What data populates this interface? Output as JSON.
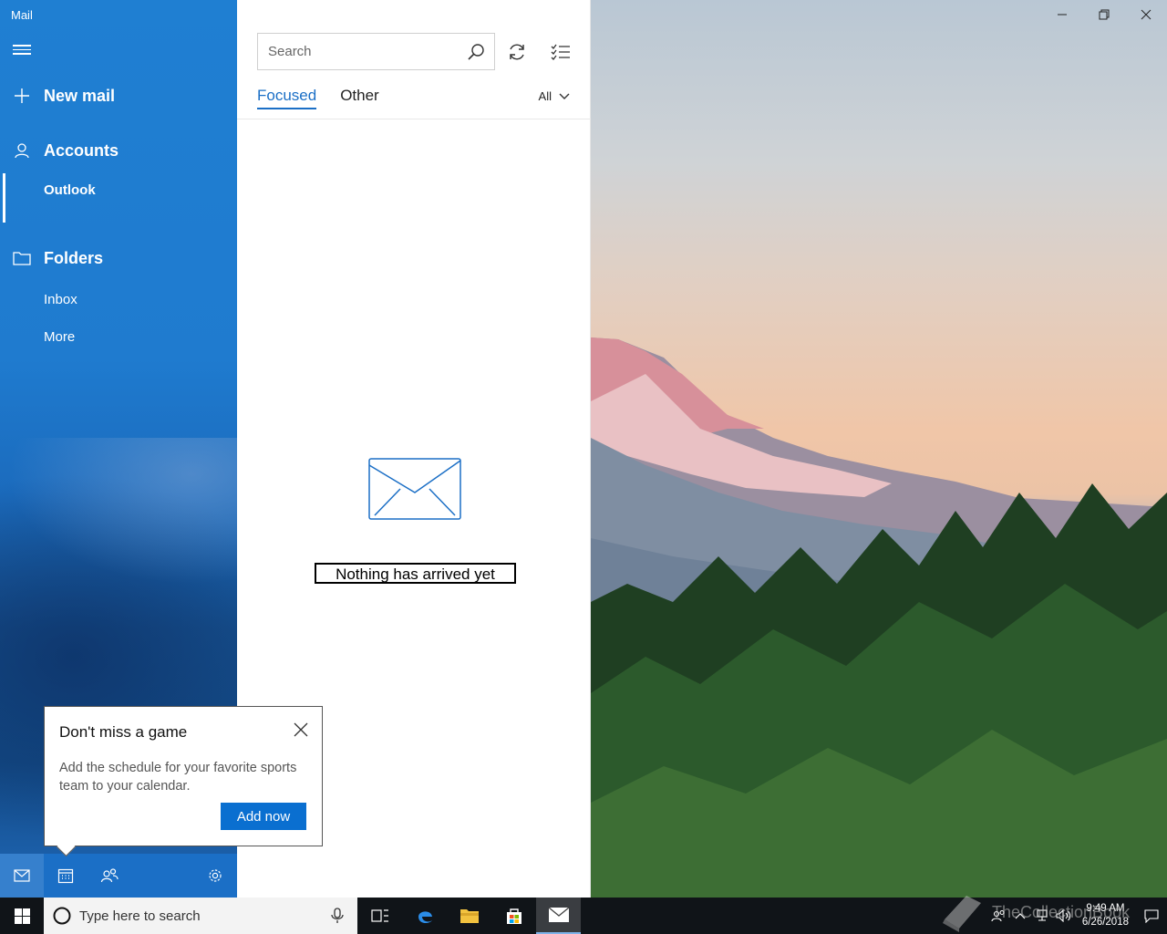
{
  "app": {
    "title": "Mail"
  },
  "nav": {
    "new_mail": "New mail",
    "accounts": "Accounts",
    "account_items": [
      "Outlook"
    ],
    "folders": "Folders",
    "folder_items": [
      "Inbox",
      "More"
    ]
  },
  "list": {
    "search": {
      "placeholder": "Search"
    },
    "tabs": [
      "Focused",
      "Other"
    ],
    "filter": "All",
    "empty_message": "Nothing has arrived yet"
  },
  "tip": {
    "title": "Don't miss a game",
    "body": "Add the schedule for your favorite sports team to your calendar.",
    "button": "Add now"
  },
  "taskbar": {
    "search_placeholder": "Type here to search",
    "time": "9:49 AM",
    "date": "6/26/2018",
    "watermark": "TheCollectionBook"
  },
  "colors": {
    "accent": "#1b6fc6",
    "nav_bg": "#1f7fd2",
    "button": "#0a6fd0",
    "taskbar": "#101418"
  }
}
